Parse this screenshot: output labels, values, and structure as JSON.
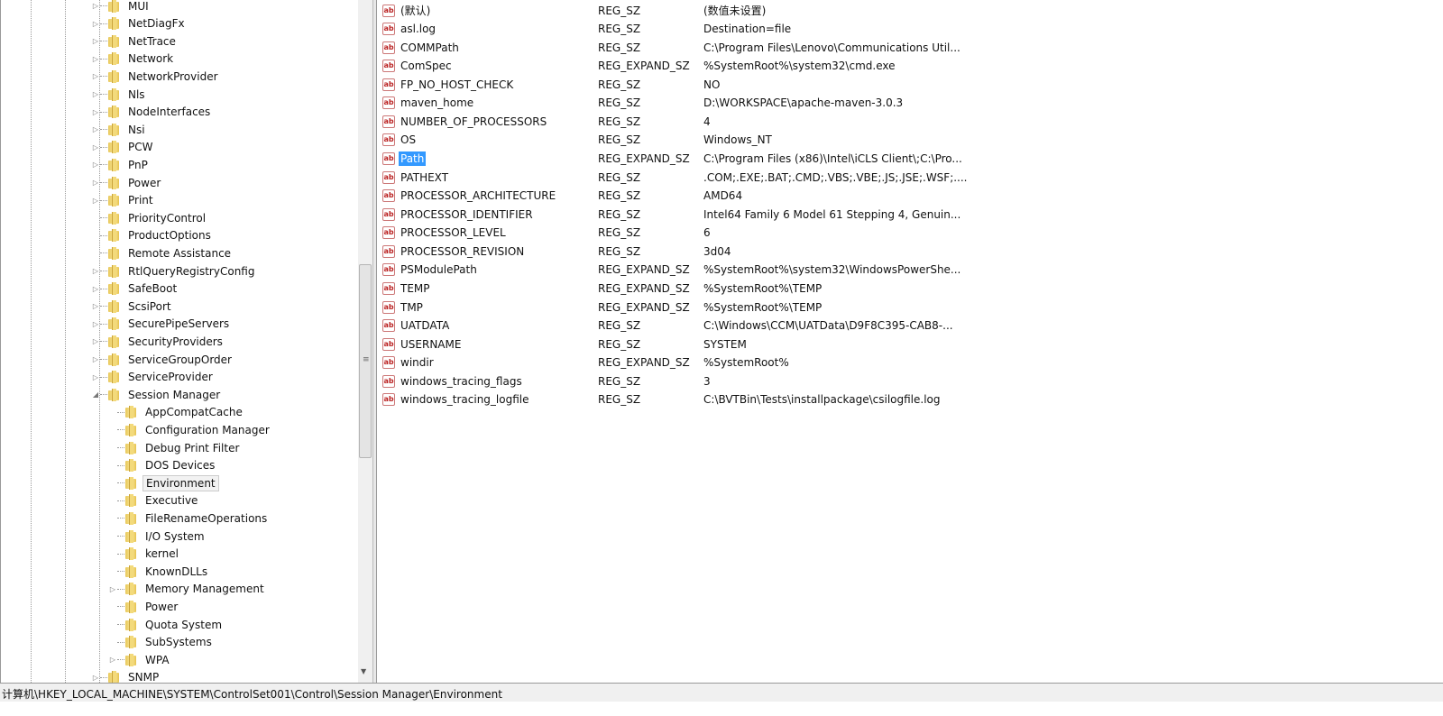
{
  "tree": {
    "items": [
      {
        "label": "MUI",
        "level": 1,
        "expander": "collapsed"
      },
      {
        "label": "NetDiagFx",
        "level": 1,
        "expander": "collapsed"
      },
      {
        "label": "NetTrace",
        "level": 1,
        "expander": "collapsed"
      },
      {
        "label": "Network",
        "level": 1,
        "expander": "collapsed"
      },
      {
        "label": "NetworkProvider",
        "level": 1,
        "expander": "collapsed"
      },
      {
        "label": "Nls",
        "level": 1,
        "expander": "collapsed"
      },
      {
        "label": "NodeInterfaces",
        "level": 1,
        "expander": "collapsed"
      },
      {
        "label": "Nsi",
        "level": 1,
        "expander": "collapsed"
      },
      {
        "label": "PCW",
        "level": 1,
        "expander": "collapsed"
      },
      {
        "label": "PnP",
        "level": 1,
        "expander": "collapsed"
      },
      {
        "label": "Power",
        "level": 1,
        "expander": "collapsed"
      },
      {
        "label": "Print",
        "level": 1,
        "expander": "collapsed"
      },
      {
        "label": "PriorityControl",
        "level": 1,
        "expander": "none"
      },
      {
        "label": "ProductOptions",
        "level": 1,
        "expander": "none"
      },
      {
        "label": "Remote Assistance",
        "level": 1,
        "expander": "none"
      },
      {
        "label": "RtlQueryRegistryConfig",
        "level": 1,
        "expander": "collapsed"
      },
      {
        "label": "SafeBoot",
        "level": 1,
        "expander": "collapsed"
      },
      {
        "label": "ScsiPort",
        "level": 1,
        "expander": "collapsed"
      },
      {
        "label": "SecurePipeServers",
        "level": 1,
        "expander": "collapsed"
      },
      {
        "label": "SecurityProviders",
        "level": 1,
        "expander": "collapsed"
      },
      {
        "label": "ServiceGroupOrder",
        "level": 1,
        "expander": "collapsed"
      },
      {
        "label": "ServiceProvider",
        "level": 1,
        "expander": "collapsed"
      },
      {
        "label": "Session Manager",
        "level": 1,
        "expander": "expanded"
      },
      {
        "label": "AppCompatCache",
        "level": 2,
        "expander": "none"
      },
      {
        "label": "Configuration Manager",
        "level": 2,
        "expander": "none"
      },
      {
        "label": "Debug Print Filter",
        "level": 2,
        "expander": "none"
      },
      {
        "label": "DOS Devices",
        "level": 2,
        "expander": "none"
      },
      {
        "label": "Environment",
        "level": 2,
        "expander": "none",
        "selected": true
      },
      {
        "label": "Executive",
        "level": 2,
        "expander": "none"
      },
      {
        "label": "FileRenameOperations",
        "level": 2,
        "expander": "none"
      },
      {
        "label": "I/O System",
        "level": 2,
        "expander": "none"
      },
      {
        "label": "kernel",
        "level": 2,
        "expander": "none"
      },
      {
        "label": "KnownDLLs",
        "level": 2,
        "expander": "none"
      },
      {
        "label": "Memory Management",
        "level": 2,
        "expander": "collapsed"
      },
      {
        "label": "Power",
        "level": 2,
        "expander": "none"
      },
      {
        "label": "Quota System",
        "level": 2,
        "expander": "none"
      },
      {
        "label": "SubSystems",
        "level": 2,
        "expander": "none"
      },
      {
        "label": "WPA",
        "level": 2,
        "expander": "collapsed"
      },
      {
        "label": "SNMP",
        "level": 1,
        "expander": "collapsed"
      }
    ]
  },
  "values": {
    "rows": [
      {
        "name": "(默认)",
        "type": "REG_SZ",
        "data": "(数值未设置)"
      },
      {
        "name": "asl.log",
        "type": "REG_SZ",
        "data": "Destination=file"
      },
      {
        "name": "COMMPath",
        "type": "REG_SZ",
        "data": "C:\\Program Files\\Lenovo\\Communications Util..."
      },
      {
        "name": "ComSpec",
        "type": "REG_EXPAND_SZ",
        "data": "%SystemRoot%\\system32\\cmd.exe"
      },
      {
        "name": "FP_NO_HOST_CHECK",
        "type": "REG_SZ",
        "data": "NO"
      },
      {
        "name": "maven_home",
        "type": "REG_SZ",
        "data": "D:\\WORKSPACE\\apache-maven-3.0.3"
      },
      {
        "name": "NUMBER_OF_PROCESSORS",
        "type": "REG_SZ",
        "data": "4"
      },
      {
        "name": "OS",
        "type": "REG_SZ",
        "data": "Windows_NT"
      },
      {
        "name": "Path",
        "type": "REG_EXPAND_SZ",
        "data": "C:\\Program Files (x86)\\Intel\\iCLS Client\\;C:\\Pro...",
        "selected": true
      },
      {
        "name": "PATHEXT",
        "type": "REG_SZ",
        "data": ".COM;.EXE;.BAT;.CMD;.VBS;.VBE;.JS;.JSE;.WSF;...."
      },
      {
        "name": "PROCESSOR_ARCHITECTURE",
        "type": "REG_SZ",
        "data": "AMD64"
      },
      {
        "name": "PROCESSOR_IDENTIFIER",
        "type": "REG_SZ",
        "data": "Intel64 Family 6 Model 61 Stepping 4, Genuin..."
      },
      {
        "name": "PROCESSOR_LEVEL",
        "type": "REG_SZ",
        "data": "6"
      },
      {
        "name": "PROCESSOR_REVISION",
        "type": "REG_SZ",
        "data": "3d04"
      },
      {
        "name": "PSModulePath",
        "type": "REG_EXPAND_SZ",
        "data": "%SystemRoot%\\system32\\WindowsPowerShe..."
      },
      {
        "name": "TEMP",
        "type": "REG_EXPAND_SZ",
        "data": "%SystemRoot%\\TEMP"
      },
      {
        "name": "TMP",
        "type": "REG_EXPAND_SZ",
        "data": "%SystemRoot%\\TEMP"
      },
      {
        "name": "UATDATA",
        "type": "REG_SZ",
        "data": "C:\\Windows\\CCM\\UATData\\D9F8C395-CAB8-..."
      },
      {
        "name": "USERNAME",
        "type": "REG_SZ",
        "data": "SYSTEM"
      },
      {
        "name": "windir",
        "type": "REG_EXPAND_SZ",
        "data": "%SystemRoot%"
      },
      {
        "name": "windows_tracing_flags",
        "type": "REG_SZ",
        "data": "3"
      },
      {
        "name": "windows_tracing_logfile",
        "type": "REG_SZ",
        "data": "C:\\BVTBin\\Tests\\installpackage\\csilogfile.log"
      }
    ]
  },
  "status_bar": {
    "path": "计算机\\HKEY_LOCAL_MACHINE\\SYSTEM\\ControlSet001\\Control\\Session Manager\\Environment"
  },
  "colors": {
    "selection": "#3399ff",
    "folder": "#f3da7b"
  }
}
